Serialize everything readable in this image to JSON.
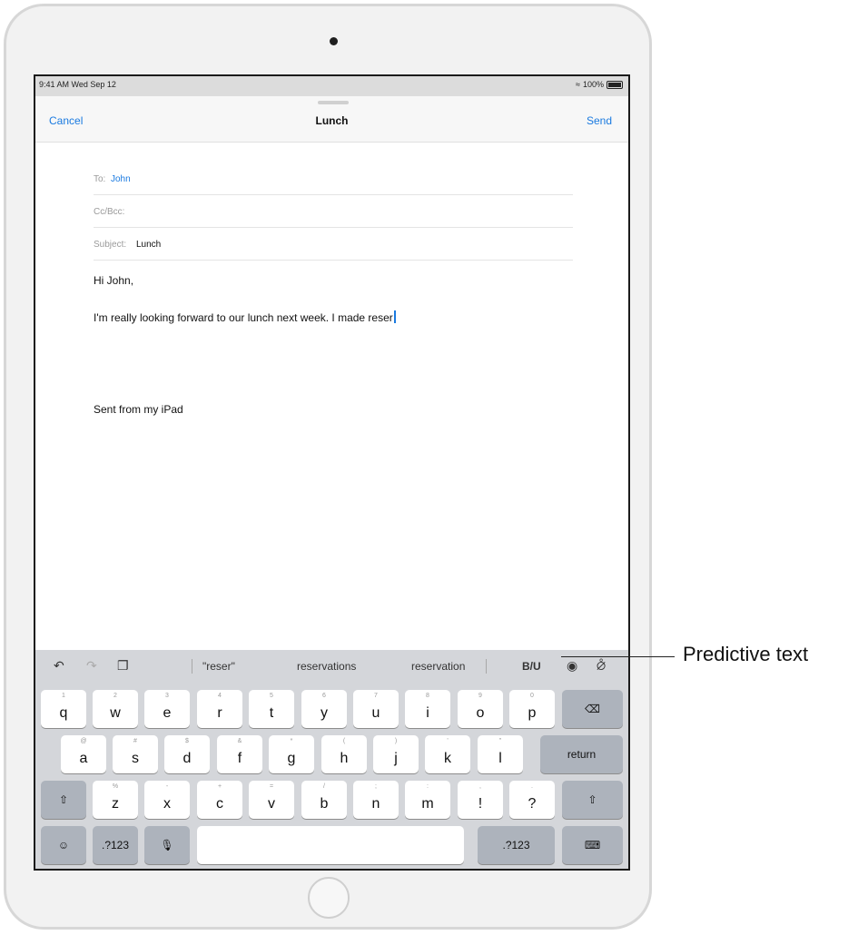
{
  "status": {
    "time": "9:41 AM  Wed Sep 12",
    "battery": "100%"
  },
  "compose": {
    "cancel": "Cancel",
    "title": "Lunch",
    "send": "Send",
    "to_label": "To:",
    "to_value": "John",
    "ccbcc_label": "Cc/Bcc:",
    "subject_label": "Subject:",
    "subject_value": "Lunch",
    "greeting": "Hi John,",
    "body": "I'm really looking forward to our lunch next week. I made reser",
    "signature": "Sent from my iPad"
  },
  "toolbar": {
    "icons": [
      "undo-icon",
      "redo-icon",
      "paste-icon",
      "camera-icon",
      "paperclip-icon"
    ],
    "predictions": [
      "\"reser\"",
      "reservations",
      "reservation"
    ],
    "format": "B/U"
  },
  "keyboard": {
    "row1": [
      {
        "main": "q",
        "hint": "1"
      },
      {
        "main": "w",
        "hint": "2"
      },
      {
        "main": "e",
        "hint": "3"
      },
      {
        "main": "r",
        "hint": "4"
      },
      {
        "main": "t",
        "hint": "5"
      },
      {
        "main": "y",
        "hint": "6"
      },
      {
        "main": "u",
        "hint": "7"
      },
      {
        "main": "i",
        "hint": "8"
      },
      {
        "main": "o",
        "hint": "9"
      },
      {
        "main": "p",
        "hint": "0"
      }
    ],
    "row2": [
      {
        "main": "a",
        "hint": "@"
      },
      {
        "main": "s",
        "hint": "#"
      },
      {
        "main": "d",
        "hint": "$"
      },
      {
        "main": "f",
        "hint": "&"
      },
      {
        "main": "g",
        "hint": "*"
      },
      {
        "main": "h",
        "hint": "("
      },
      {
        "main": "j",
        "hint": ")"
      },
      {
        "main": "k",
        "hint": "'"
      },
      {
        "main": "l",
        "hint": "\""
      }
    ],
    "row3": [
      {
        "main": "z",
        "hint": "%"
      },
      {
        "main": "x",
        "hint": "-"
      },
      {
        "main": "c",
        "hint": "+"
      },
      {
        "main": "v",
        "hint": "="
      },
      {
        "main": "b",
        "hint": "/"
      },
      {
        "main": "n",
        "hint": ";"
      },
      {
        "main": "m",
        "hint": ":"
      },
      {
        "main": "!",
        "hint": ","
      },
      {
        "main": "?",
        "hint": "."
      }
    ],
    "return_label": "return",
    "numbers_label": ".?123",
    "delete_icon": "backspace-icon",
    "shift_icon": "shift-icon",
    "emoji_icon": "emoji-icon",
    "mic_icon": "microphone-icon",
    "hide_icon": "keyboard-hide-icon"
  },
  "callout": {
    "label": "Predictive text"
  }
}
